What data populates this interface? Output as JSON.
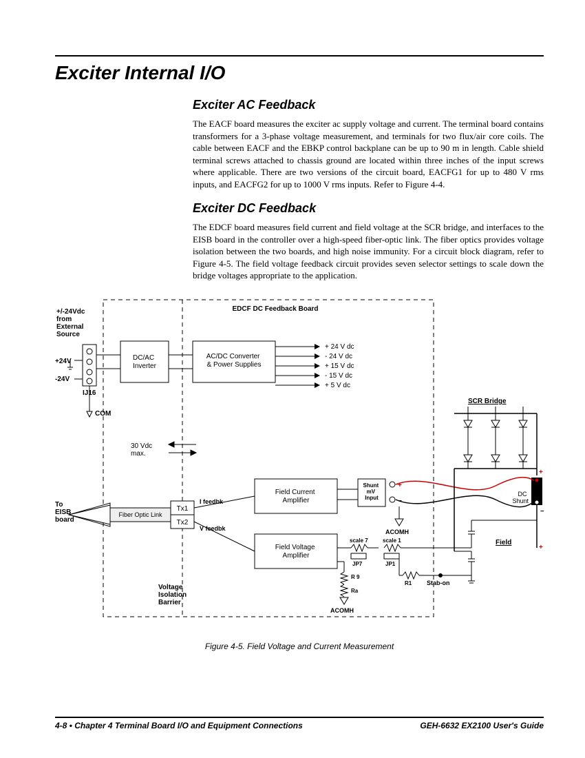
{
  "page_title": "Exciter Internal I/O",
  "sections": {
    "ac": {
      "heading": "Exciter AC Feedback",
      "body": "The EACF board measures the exciter ac supply voltage and current. The terminal board contains transformers for a 3-phase voltage measurement, and terminals for two flux/air core coils. The cable between EACF and the EBKP control backplane can be up to 90 m in length. Cable shield terminal screws attached to chassis ground are located within three inches of the input screws where applicable. There are two versions of the circuit board, EACFG1 for up to 480 V rms inputs, and EACFG2 for up to 1000 V rms inputs. Refer to Figure 4-4."
    },
    "dc": {
      "heading": "Exciter DC Feedback",
      "body": "The EDCF board measures field current and field voltage at the SCR bridge, and interfaces to the EISB board in the controller over a high-speed fiber-optic link. The fiber optics provides voltage isolation between the two boards, and high noise immunity. For a circuit block diagram, refer to Figure 4-5. The field voltage feedback circuit provides seven selector settings to scale down the bridge voltages appropriate to the application."
    }
  },
  "figure": {
    "caption": "Figure 4-5.  Field Voltage and Current Measurement",
    "labels": {
      "board_title": "EDCF DC Feedback Board",
      "ext_source": "+/-24Vdc\nfrom\nExternal\nSource",
      "plus24": "+24V",
      "minus24": "-24V",
      "ij16": "IJ16",
      "com": "COM",
      "dcac": "DC/AC\nInverter",
      "acdc": "AC/DC Converter\n& Power Supplies",
      "rails": [
        "+ 24 V dc",
        "- 24 V dc",
        "+ 15 V dc",
        "- 15 V dc",
        "+ 5  V dc"
      ],
      "v30": "30 Vdc\nmax.",
      "fca": "Field Current\nAmplifier",
      "fva": "Field Voltage\nAmplifier",
      "shunt_in": "Shunt\nmV\nInput",
      "tx1": "Tx1",
      "tx2": "Tx2",
      "ifb": "I feedbk",
      "vfb": "V feedbk",
      "to_eisb": "To\nEISB\nboard",
      "fiber": "Fiber Optic Link",
      "vib": "Voltage\nIsolation\nBarrier",
      "acomh": "ACOMH",
      "r9": "R 9",
      "ra": "Ra",
      "r1": "R1",
      "scale7": "scale 7",
      "scale1": "scale 1",
      "jp7": "JP7",
      "jp1": "JP1",
      "stabon": "Stab-on",
      "scr": "SCR Bridge",
      "dcshunt": "DC\nShunt",
      "field": "Field",
      "plus": "+",
      "minus": "−"
    }
  },
  "footer": {
    "left": "4-8 • Chapter 4 Terminal Board I/O and Equipment Connections",
    "right": "GEH-6632  EX2100 User's Guide"
  }
}
